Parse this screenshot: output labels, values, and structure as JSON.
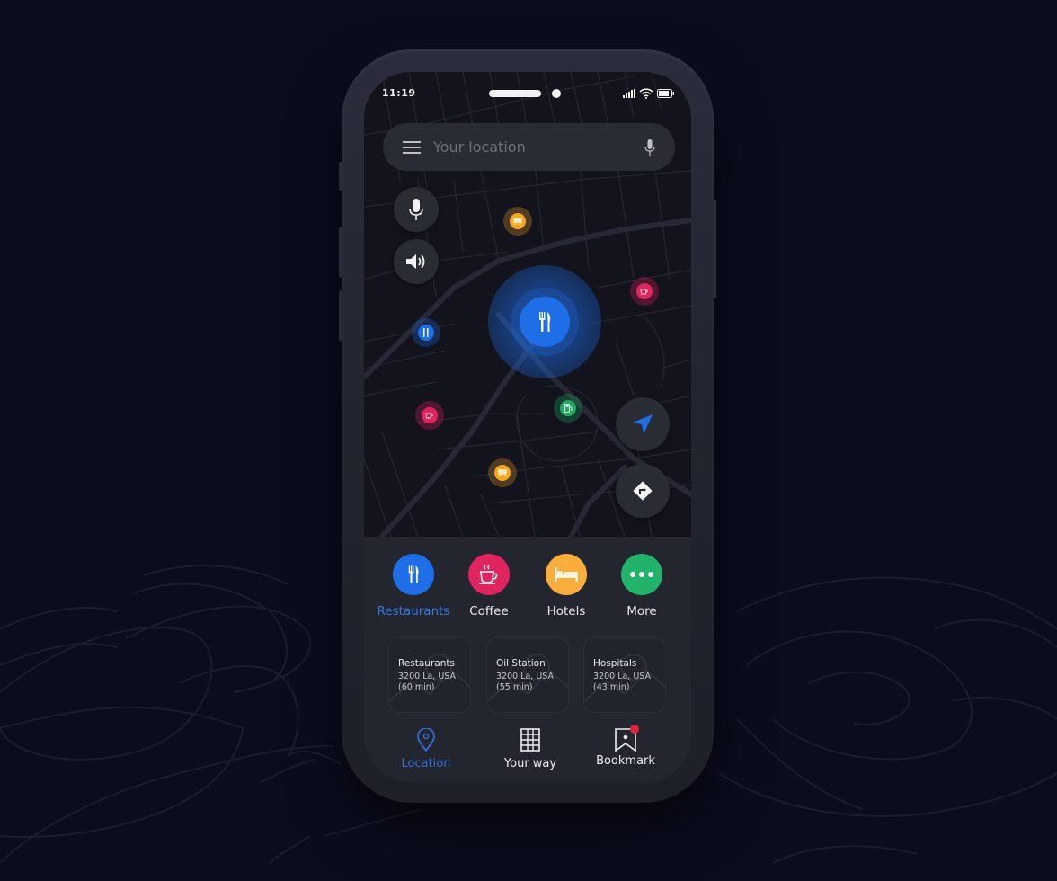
{
  "status_bar": {
    "time": "11:19",
    "icons": [
      "signal-icon",
      "wifi-icon",
      "battery-icon"
    ]
  },
  "search": {
    "menu_icon": "hamburger-menu-icon",
    "placeholder": "Your location",
    "voice_icon": "microphone-icon"
  },
  "map_controls": {
    "left": [
      {
        "name": "voice-search-button",
        "icon": "microphone-icon"
      },
      {
        "name": "sound-toggle-button",
        "icon": "speaker-icon"
      }
    ],
    "right": [
      {
        "name": "my-location-button",
        "icon": "navigation-arrow-icon"
      },
      {
        "name": "directions-button",
        "icon": "directions-turn-icon"
      }
    ]
  },
  "map_markers": [
    {
      "type": "bus",
      "icon": "bus-icon",
      "color": "#f5a623"
    },
    {
      "type": "coffee",
      "icon": "coffee-icon",
      "color": "#e0245e"
    },
    {
      "type": "restaurant",
      "icon": "cutlery-icon",
      "color": "#1e6ee8"
    },
    {
      "type": "restaurant-selected",
      "icon": "cutlery-icon",
      "color": "#1e6ee8"
    },
    {
      "type": "coffee",
      "icon": "coffee-icon",
      "color": "#e0245e"
    },
    {
      "type": "gas",
      "icon": "gas-station-icon",
      "color": "#22a861"
    },
    {
      "type": "bus",
      "icon": "bus-icon",
      "color": "#f5a623"
    }
  ],
  "categories": [
    {
      "label": "Restaurants",
      "icon": "cutlery-icon",
      "color": "#1e6ee8",
      "active": true
    },
    {
      "label": "Coffee",
      "icon": "coffee-cup-icon",
      "color": "#e0245e",
      "active": false
    },
    {
      "label": "Hotels",
      "icon": "bed-icon",
      "color": "#f9ae3b",
      "active": false
    },
    {
      "label": "More",
      "icon": "more-dots-icon",
      "color": "#22b36b",
      "active": false
    }
  ],
  "places": [
    {
      "title": "Restaurants",
      "address": "3200 La, USA",
      "duration": "(60 min)"
    },
    {
      "title": "Oil Station",
      "address": "3200 La, USA",
      "duration": "(55 min)"
    },
    {
      "title": "Hospitals",
      "address": "3200 La, USA",
      "duration": "(43 min)"
    }
  ],
  "bottom_nav": [
    {
      "label": "Location",
      "icon": "location-pin-icon",
      "active": true
    },
    {
      "label": "Your way",
      "icon": "grid-map-icon",
      "active": false
    },
    {
      "label": "Bookmark",
      "icon": "bookmark-icon",
      "active": false,
      "badge": true
    }
  ],
  "colors": {
    "accent": "#1e6ee8",
    "background": "#0b0d1e",
    "panel": "#24262f",
    "map": "#12131d",
    "badge": "#e0243a"
  }
}
